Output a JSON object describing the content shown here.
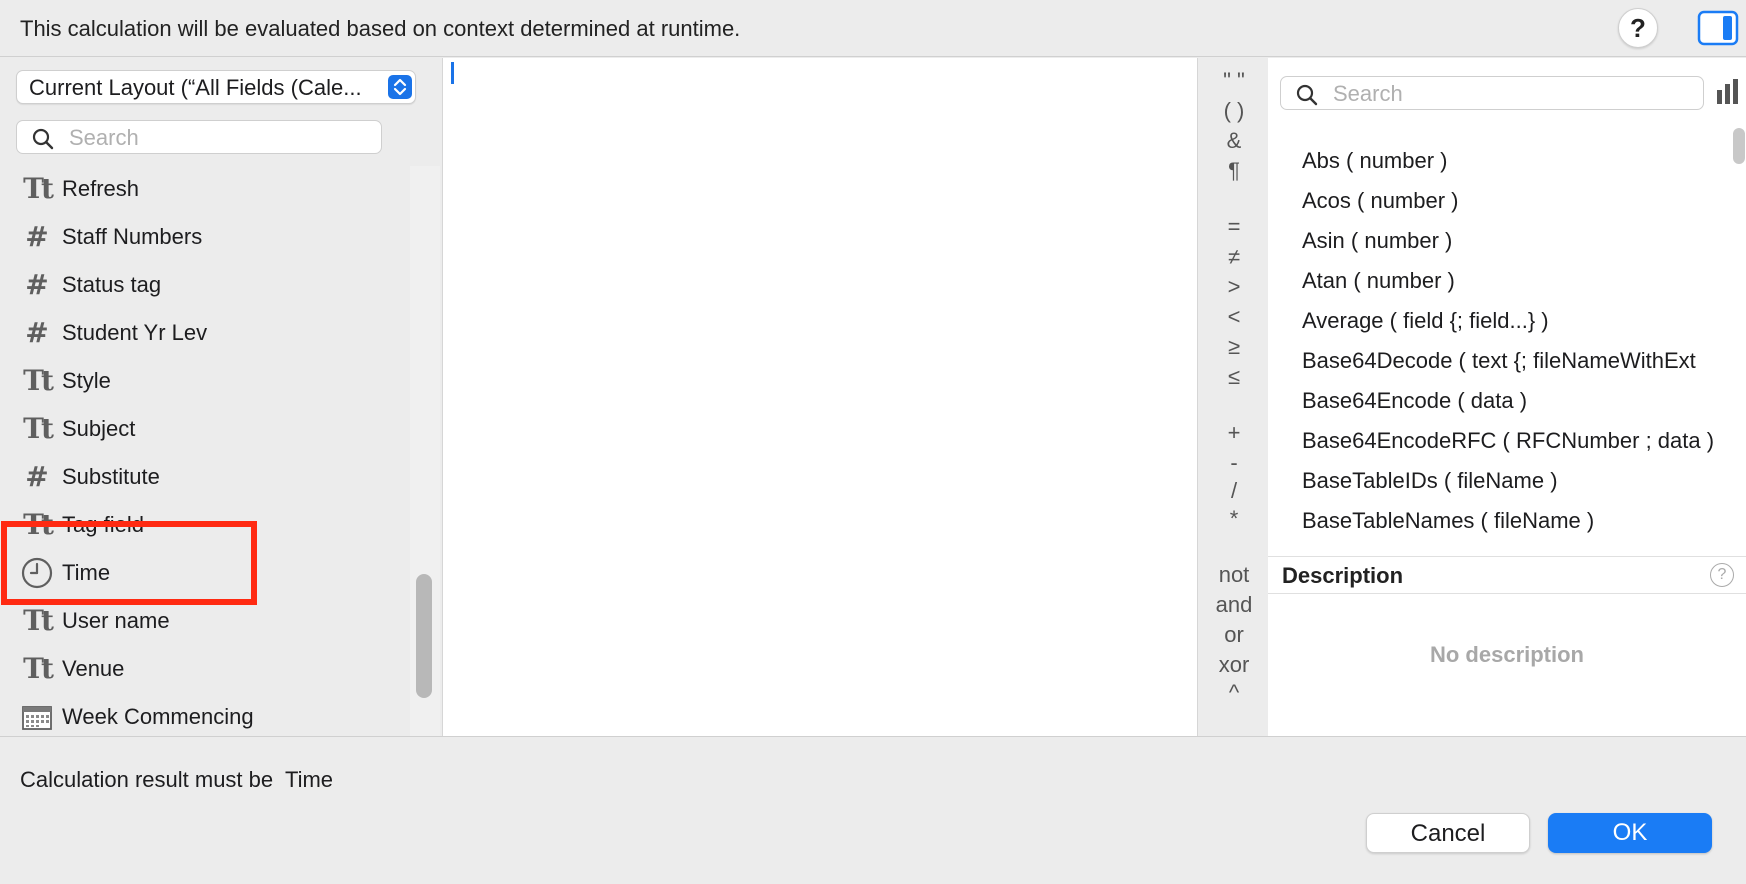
{
  "header": {
    "message": "This calculation will be evaluated based on context determined at runtime.",
    "help_label": "?"
  },
  "context": {
    "selected": "Current Layout (“All Fields (Cale..."
  },
  "field_search": {
    "placeholder": "Search"
  },
  "fields": [
    {
      "type": "text",
      "icon": "Tt",
      "label": "Refresh"
    },
    {
      "type": "number",
      "icon": "#",
      "label": "Staff Numbers"
    },
    {
      "type": "number",
      "icon": "#",
      "label": "Status tag"
    },
    {
      "type": "number",
      "icon": "#",
      "label": "Student Yr Lev"
    },
    {
      "type": "text",
      "icon": "Tt",
      "label": "Style"
    },
    {
      "type": "text",
      "icon": "Tt",
      "label": "Subject"
    },
    {
      "type": "number",
      "icon": "#",
      "label": "Substitute"
    },
    {
      "type": "text",
      "icon": "Tt",
      "label": "Tag field"
    },
    {
      "type": "time",
      "icon": "",
      "label": "Time"
    },
    {
      "type": "text",
      "icon": "Tt",
      "label": "User name"
    },
    {
      "type": "text",
      "icon": "Tt",
      "label": "Venue"
    },
    {
      "type": "date",
      "icon": "",
      "label": "Week Commencing"
    }
  ],
  "operators": {
    "group1": [
      "\" \"",
      "( )",
      "&",
      "¶"
    ],
    "group2": [
      "=",
      "≠",
      ">",
      "<",
      "≥",
      "≤"
    ],
    "group3": [
      "+",
      "-",
      "/",
      "*"
    ],
    "group4": [
      "not",
      "and",
      "or",
      "xor",
      "^"
    ]
  },
  "function_search": {
    "placeholder": "Search"
  },
  "functions": [
    "Abs ( number )",
    "Acos ( number )",
    "Asin ( number )",
    "Atan ( number )",
    "Average ( field {; field...} )",
    "Base64Decode ( text {; fileNameWithExt",
    "Base64Encode ( data )",
    "Base64EncodeRFC ( RFCNumber ; data )",
    "BaseTableIDs ( fileName )",
    "BaseTableNames ( fileName )"
  ],
  "description": {
    "title": "Description",
    "help_label": "?",
    "body": "No description"
  },
  "footer": {
    "result_label": "Calculation result must be  Time",
    "cancel_label": "Cancel",
    "ok_label": "OK"
  },
  "colors": {
    "accent": "#1a7cf5",
    "highlight": "#ff2a12"
  }
}
